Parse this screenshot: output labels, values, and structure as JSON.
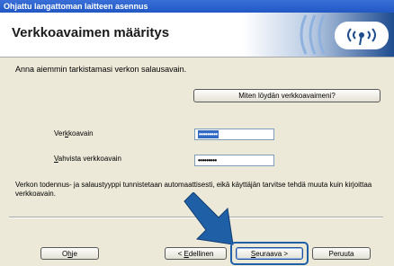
{
  "window": {
    "title": "Ohjattu langattoman laitteen asennus"
  },
  "header": {
    "title": "Verkkoavaimen määritys",
    "banner_icon": "wireless-signal-icon"
  },
  "main": {
    "intro": "Anna aiemmin tarkistamasi verkon salausavain.",
    "help_link_button": "Miten löydän verkkoavaimeni?",
    "network_key_label_pre": "Ver",
    "network_key_label_u": "k",
    "network_key_label_post": "koavain",
    "network_key_value": "•••••••••",
    "confirm_key_label_u": "V",
    "confirm_key_label_post": "ahvista verkkoavain",
    "confirm_key_value": "•••••••••",
    "info": "Verkon todennus- ja salaustyyppi tunnistetaan automaattisesti, eikä käyttäjän tarvitse tehdä muuta kuin kirjoittaa verkkoavain."
  },
  "footer": {
    "help_pre": "O",
    "help_u": "h",
    "help_post": "je",
    "back_pre": "< ",
    "back_u": "E",
    "back_post": "dellinen",
    "next_u": "S",
    "next_post": "euraava >",
    "cancel": "Peruuta"
  },
  "colors": {
    "title_bar": "#2158c4",
    "highlight": "#1d5fa8",
    "arrow": "#1f5fa6"
  }
}
